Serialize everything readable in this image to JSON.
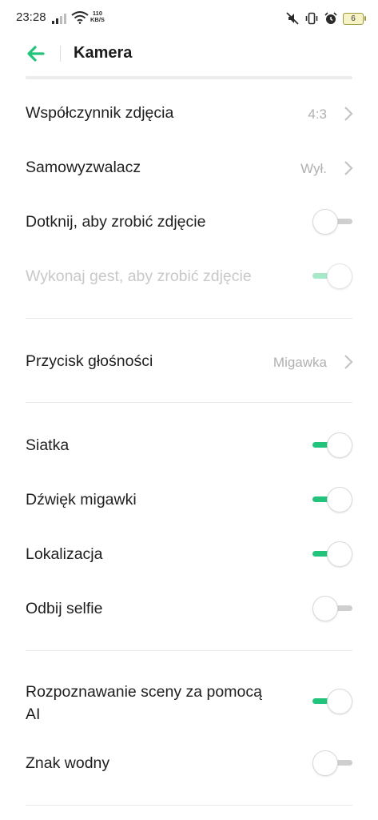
{
  "status_bar": {
    "time": "23:28",
    "speed_value": "110",
    "speed_unit": "KB/S",
    "battery": "6"
  },
  "header": {
    "title": "Kamera"
  },
  "settings": {
    "aspect_ratio": {
      "label": "Współczynnik zdjęcia",
      "value": "4:3"
    },
    "self_timer": {
      "label": "Samowyzwalacz",
      "value": "Wył."
    },
    "touch_capture": {
      "label": "Dotknij, aby zrobić zdjęcie",
      "state": "off"
    },
    "gesture_capture": {
      "label": "Wykonaj gest, aby zrobić zdjęcie",
      "state": "on",
      "enabled": false
    },
    "volume_button": {
      "label": "Przycisk głośności",
      "value": "Migawka"
    },
    "grid": {
      "label": "Siatka",
      "state": "on"
    },
    "shutter_sound": {
      "label": "Dźwięk migawki",
      "state": "on"
    },
    "location": {
      "label": "Lokalizacja",
      "state": "on"
    },
    "mirror_selfie": {
      "label": "Odbij selfie",
      "state": "off"
    },
    "ai_scene": {
      "label_line1": "Rozpoznawanie sceny za pomocą",
      "label_line2": "AI",
      "state": "on"
    },
    "watermark": {
      "label": "Znak wodny",
      "state": "off"
    }
  },
  "colors": {
    "accent": "#21c47a",
    "accent_disabled": "#a6e8c8",
    "secondary_text": "#b0b0b0",
    "disabled_text": "#c8c8c8"
  },
  "icons": [
    "back-arrow-icon",
    "chevron-right-icon",
    "mute-icon",
    "vibrate-icon",
    "alarm-icon",
    "wifi-icon",
    "signal-icon",
    "battery-icon"
  ]
}
